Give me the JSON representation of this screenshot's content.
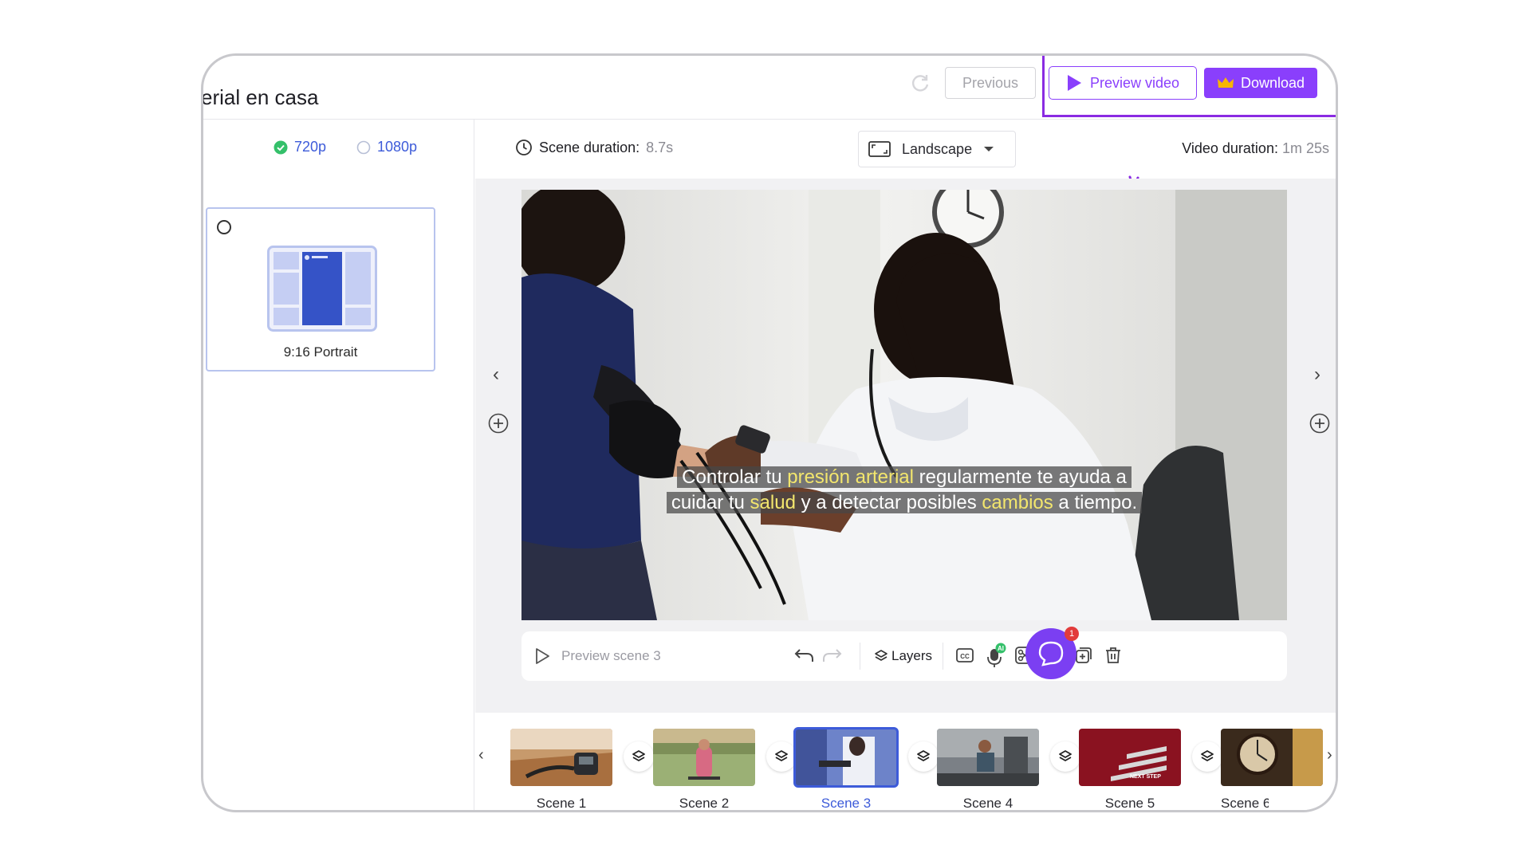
{
  "header": {
    "project_title": "erial en casa",
    "previous_label": "Previous",
    "preview_video_label": "Preview video",
    "download_label": "Download"
  },
  "left_panel": {
    "resolution_options": [
      {
        "label": "720p",
        "selected": true
      },
      {
        "label": "1080p",
        "selected": false
      }
    ],
    "portrait_card_label": "9:16 Portrait"
  },
  "main": {
    "scene_duration_label": "Scene duration:",
    "scene_duration_value": "8.7s",
    "orientation_label": "Landscape",
    "video_duration_label": "Video duration:",
    "video_duration_value": "1m 25s"
  },
  "subtitle": {
    "line1": [
      "Controlar tu ",
      "presión arterial",
      " regularmente te ayuda a"
    ],
    "line2": [
      "cuidar tu ",
      "salud",
      " y a detectar posibles ",
      "cambios",
      " a tiempo."
    ]
  },
  "toolbar": {
    "preview_scene_label": "Preview scene 3",
    "layers_label": "Layers",
    "ai_badge": "AI"
  },
  "filmstrip": {
    "scenes": [
      {
        "label": "Scene 1"
      },
      {
        "label": "Scene 2"
      },
      {
        "label": "Scene 3",
        "active": true
      },
      {
        "label": "Scene 4"
      },
      {
        "label": "Scene 5"
      },
      {
        "label": "Scene 6"
      }
    ],
    "scene5_text": "NEXT STEP"
  },
  "chat": {
    "badge_count": "1"
  },
  "colors": {
    "accent": "#8a3ffc",
    "highlight": "#8a2be2",
    "active_blue": "#3d5bd9",
    "subtitle_highlight": "#f3e66d"
  }
}
